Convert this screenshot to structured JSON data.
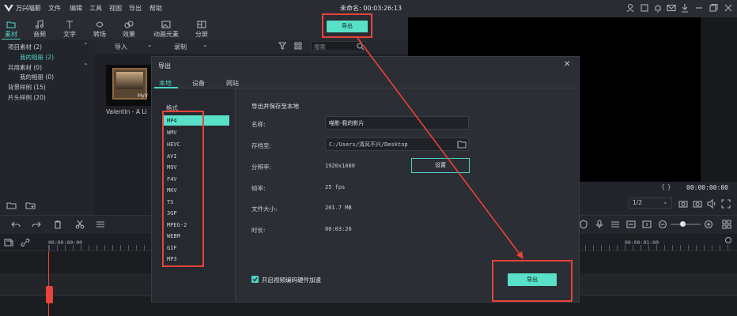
{
  "app": {
    "name": "万兴喵影",
    "menus": [
      "文件",
      "编辑",
      "工具",
      "视图",
      "导出",
      "帮助"
    ],
    "project_title": "未命名: 00:03:26:13"
  },
  "toolbar": {
    "tabs": [
      "素材",
      "音频",
      "文字",
      "转场",
      "效果",
      "动画元素",
      "分屏"
    ],
    "export_label": "导出"
  },
  "library": {
    "items": [
      {
        "label": "项目素材 (2)",
        "level": 0
      },
      {
        "label": "我的相册 (2)",
        "level": 1,
        "selected": true
      },
      {
        "label": "共用素材 (0)",
        "level": 0
      },
      {
        "label": "我的相册 (0)",
        "level": 1
      },
      {
        "label": "背景样例 (15)",
        "level": 0
      },
      {
        "label": "片头样例 (20)",
        "level": 0
      }
    ],
    "import_label": "导入",
    "record_label": "录制",
    "search_placeholder": "搜索",
    "clip_name": "Valentin - A Li",
    "thumb_text": "MyV"
  },
  "preview": {
    "timecode": "00:00:00:00",
    "quality": "1/2",
    "brackets": "{ }"
  },
  "timeline": {
    "ruler_start": "00:00:00:00",
    "ruler_end": "00:00:01:00"
  },
  "dialog": {
    "title": "导出",
    "tabs": [
      "本地",
      "设备",
      "网站"
    ],
    "format_label": "格式",
    "formats": [
      "MP4",
      "WMV",
      "HEVC",
      "AVI",
      "MOV",
      "F4V",
      "MKV",
      "TS",
      "3GP",
      "MPEG-2",
      "WEBM",
      "GIF",
      "MP3"
    ],
    "selected_format": "MP4",
    "section_title": "导出并保存至本地",
    "name_label": "名称:",
    "name_value": "喵影-我的影片",
    "path_label": "存档至:",
    "path_value": "C:/Users/清风不兴/Desktop",
    "resolution_label": "分辨率:",
    "resolution_value": "1920x1080",
    "settings_label": "设置",
    "framerate_label": "帧率:",
    "framerate_value": "25 fps",
    "filesize_label": "文件大小:",
    "filesize_value": "201.7 MB",
    "duration_label": "时长:",
    "duration_value": "00:03:26",
    "hw_accel_label": "开启视频编码硬件加速",
    "hw_accel_checked": true,
    "export_label": "导出"
  },
  "colors": {
    "accent": "#4fd1c5",
    "button": "#58e0c8",
    "annotation": "#e8433a"
  }
}
